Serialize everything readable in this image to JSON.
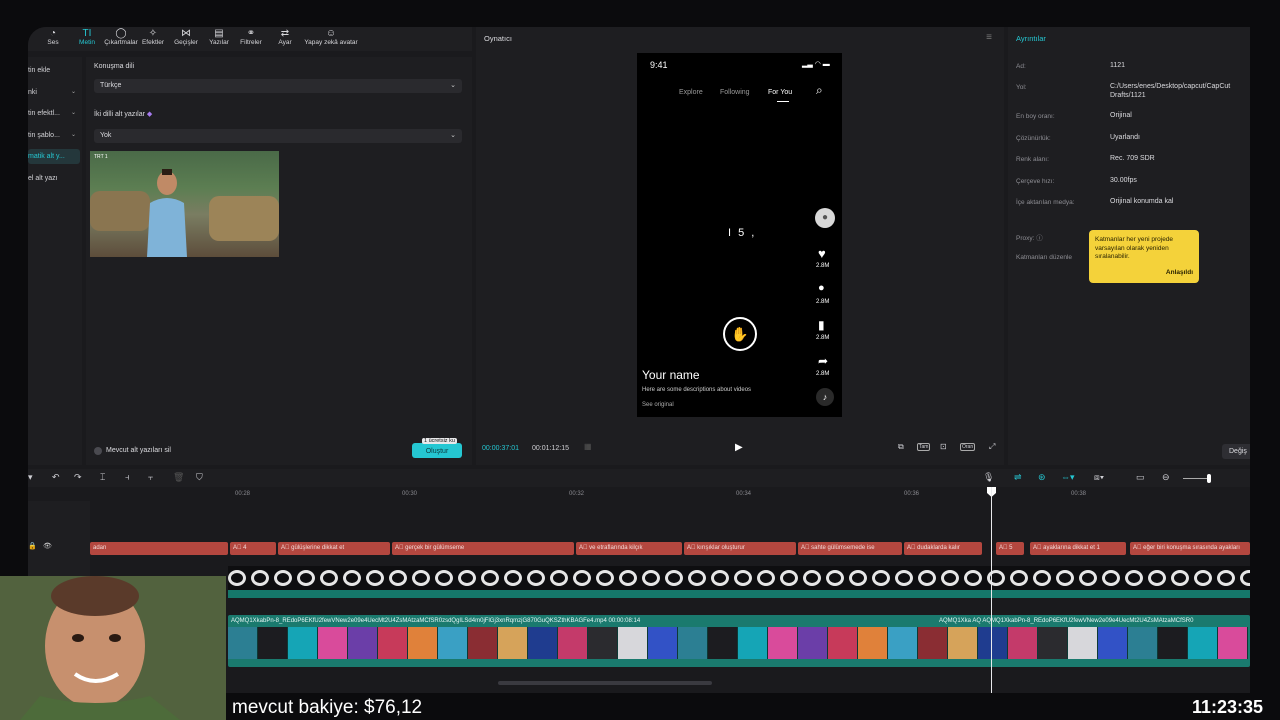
{
  "toolbar": {
    "items": [
      {
        "label": "Ses",
        "icon": "audio-icon"
      },
      {
        "label": "Metin",
        "icon": "text-icon",
        "active": true
      },
      {
        "label": "Çıkartmalar",
        "icon": "sticker-icon"
      },
      {
        "label": "Efektler",
        "icon": "effects-icon"
      },
      {
        "label": "Geçişler",
        "icon": "transitions-icon"
      },
      {
        "label": "Yazılar",
        "icon": "captions-icon"
      },
      {
        "label": "Filtreler",
        "icon": "filters-icon"
      },
      {
        "label": "Ayar",
        "icon": "adjust-icon"
      },
      {
        "label": "Yapay zekâ avatar",
        "icon": "ai-avatar-icon"
      }
    ]
  },
  "left_menu": {
    "items": [
      {
        "label": "tin ekle",
        "chevron": false
      },
      {
        "label": "nki",
        "chevron": true
      },
      {
        "label": "tin efektl...",
        "chevron": true
      },
      {
        "label": "tin şablo...",
        "chevron": true
      },
      {
        "label": "matik alt y...",
        "chevron": false,
        "active": true
      },
      {
        "label": "el alt yazı",
        "chevron": false
      }
    ]
  },
  "text_panel": {
    "language_label": "Konuşma dili",
    "language_value": "Türkçe",
    "bilingual_label": "İki dilli alt yazılar",
    "bilingual_value": "Yok",
    "thumb_tag": "TRT 1",
    "clear_label": "Mevcut alt yazıları sil",
    "generate_label": "Oluştur",
    "free_badge": "1 ücretsiz ku"
  },
  "player": {
    "title": "Oynatıcı",
    "current_time": "00:00:37:01",
    "total_time": "00:01:12:15",
    "icons": [
      "Tam",
      "Oran"
    ],
    "phone": {
      "time": "9:41",
      "tabs": [
        "Explore",
        "Following",
        "For You"
      ],
      "active_tab": "For You",
      "center_text": "I 5 ,",
      "counts": [
        "2.8M",
        "2.8M",
        "2.8M",
        "2.8M"
      ],
      "username": "Your name",
      "description": "Here are some descriptions about videos",
      "see_original": "See original"
    }
  },
  "details": {
    "title": "Ayrıntılar",
    "rows": [
      {
        "key": "Ad:",
        "value": "1121"
      },
      {
        "key": "Yol:",
        "value": "C:/Users/enes/Desktop/capcut/CapCut",
        "value2": "Drafts/1121"
      },
      {
        "key": "En boy oranı:",
        "value": "Orijinal"
      },
      {
        "key": "Çözünürlük:",
        "value": "Uyarlandı"
      },
      {
        "key": "Renk alanı:",
        "value": "Rec. 709 SDR"
      },
      {
        "key": "Çerçeve hızı:",
        "value": "30.00fps"
      },
      {
        "key": "İçe aktarılan medya:",
        "value": "Orijinal konumda kal"
      }
    ],
    "proxy_label": "Proxy:",
    "layers_label": "Katmanları düzenle",
    "tooltip_text": "Katmanlar her yeni projede varsayılan olarak yeniden sıralanabilir.",
    "tooltip_ok": "Anlaşıldı",
    "change_label": "Değiş"
  },
  "timeline": {
    "ruler": [
      "00:28",
      "00:30",
      "00:32",
      "00:34",
      "00:36",
      "00:38"
    ],
    "subtitles": [
      {
        "text": "adan"
      },
      {
        "text": "A⃞ 4"
      },
      {
        "text": "A⃞ gülüşlerine dikkat et"
      },
      {
        "text": "A⃞ gerçek bir gülümseme"
      },
      {
        "text": "A⃞ ve etraflarında kilçık"
      },
      {
        "text": "A⃞ kırışıklar oluşturur"
      },
      {
        "text": "A⃞ sahte gülümsemede ise"
      },
      {
        "text": "A⃞ dudaklarda kalır"
      },
      {
        "text": "A⃞ 5"
      },
      {
        "text": "A⃞ ayaklarına dikkat et 1"
      },
      {
        "text": "A⃞ eğer biri konuşma sırasında ayakları"
      }
    ],
    "video_label": "AQMQ1XkabPn-8_REdoP6EKfU2fewVNew2e09e4UecMt2U4ZsMAtzaMCfSR0zsdQgILSd4m0jFlGj3xnRqmzjG870GuQKSZthKBAGFe4.mp4   00:00:08:14",
    "video_label2": "AQMQ1Xka  AQ  AQMQ1XkabPn-8_REdoP6EKfU2fewVNew2e09e4UecMt2U4ZsMAtzaMCfSR0"
  },
  "overlay": {
    "balance": "mevcut bakiye: $76,12",
    "clock": "11:23:35"
  },
  "colors": {
    "accent": "#25c7d2",
    "subtitle": "#b4473f",
    "video": "#1a7a6e",
    "tooltip": "#f4d23a"
  }
}
